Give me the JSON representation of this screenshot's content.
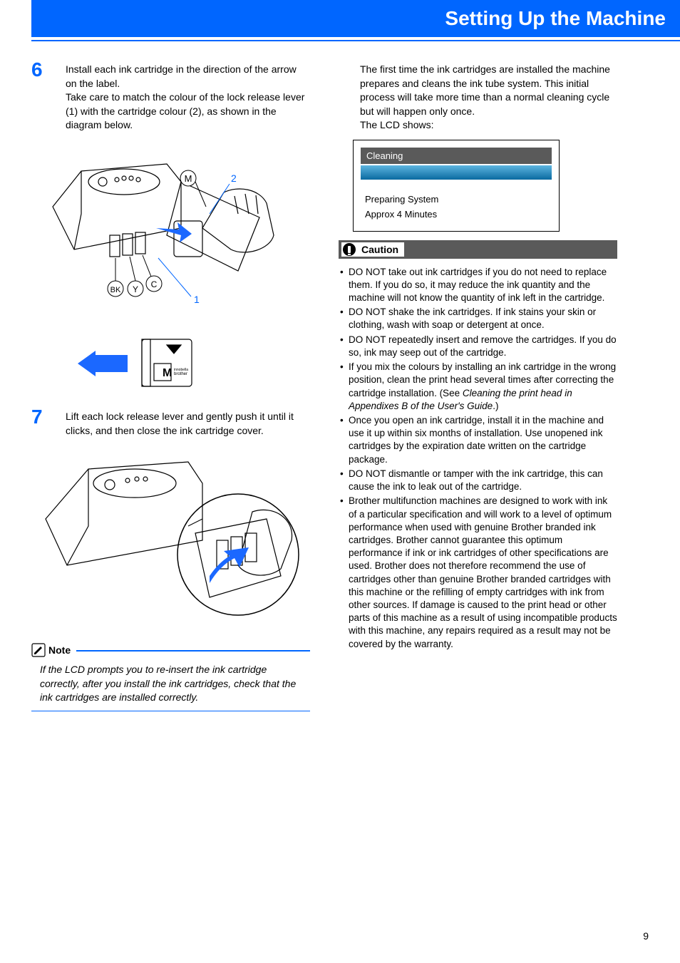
{
  "header": {
    "title": "Setting Up the Machine"
  },
  "left": {
    "step6": {
      "num": "6",
      "text": "Install each ink cartridge in the direction of the arrow on the label.\nTake care to match the colour of the lock release lever (1) with the cartridge colour (2), as shown in the diagram below."
    },
    "diagram1": {
      "labels": {
        "tl": "M",
        "tr": "2",
        "bl_bk": "BK",
        "bl_y": "Y",
        "bl_c": "C",
        "br": "1",
        "small_m": "M",
        "small_brand": "brother"
      }
    },
    "step7": {
      "num": "7",
      "text": "Lift each lock release lever and gently push it until it clicks, and then close the ink cartridge cover."
    },
    "note": {
      "label": "Note",
      "body": "If the LCD prompts you to re-insert the ink cartridge correctly, after you install the ink cartridges, check that the ink cartridges are installed correctly."
    }
  },
  "right": {
    "intro": "The first time the ink cartridges are installed the machine prepares and cleans the ink tube system. This initial process will take more time than a normal cleaning cycle but will happen only once.\nThe LCD shows:",
    "lcd": {
      "title": "Cleaning",
      "line1": "Preparing System",
      "line2": "Approx 4 Minutes"
    },
    "caution": {
      "label": "Caution",
      "items": [
        "DO NOT take out ink cartridges if you do not need to replace them. If you do so, it may reduce the ink quantity and the machine will not know the quantity of ink left in the cartridge.",
        "DO NOT shake the ink cartridges. If ink stains your skin or clothing, wash with soap or detergent at once.",
        "DO NOT repeatedly insert and remove the cartridges. If you do so, ink may seep out of the cartridge.",
        "If you mix the colours by installing an ink cartridge in the wrong position, clean the print head several times after correcting the cartridge installation. (See Cleaning the print head in Appendixes B of the User's Guide.)",
        "Once you open an ink cartridge, install it in the machine and use it up within six months of installation. Use unopened ink cartridges by the expiration date written on the cartridge package.",
        "DO NOT dismantle or tamper with the ink cartridge, this can cause the ink to leak out of the cartridge.",
        "Brother multifunction machines are designed to work with ink of a particular specification and will work to a level of optimum performance when used with genuine Brother branded ink cartridges. Brother cannot guarantee this optimum performance if ink or ink cartridges of other specifications are used. Brother does not therefore recommend the use of cartridges other than genuine Brother branded cartridges with this machine or the refilling of empty cartridges with ink from other sources. If damage is caused to the print head or other parts of this machine as a result of using incompatible products with this machine, any repairs required as a result may not be covered by the warranty."
      ]
    }
  },
  "page_number": "9"
}
